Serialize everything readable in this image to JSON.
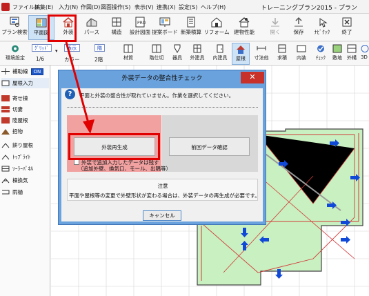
{
  "menubar": {
    "items": [
      "ファイル(F)",
      "編集(E)",
      "入力(N)",
      "作図(D)",
      "図面操作(S)",
      "表示(V)",
      "連携(X)",
      "設定(S)",
      "ヘルプ(H)"
    ],
    "window_title": "トレーニングプラン2015 - プラン"
  },
  "toolbar1": {
    "buttons": [
      "プラン検索",
      "平面図",
      "外装",
      "パース",
      "構造",
      "設計図面",
      "提案ボード",
      "新築積算",
      "リフォーム",
      "建物性能",
      "開く",
      "保存",
      "ﾅﾋﾞｸｯｸ",
      "終了"
    ]
  },
  "toolbar2": {
    "buttons": [
      "環境設定",
      "階仕切",
      "器具",
      "外建具",
      "内建具",
      "屋根",
      "寸法他",
      "求積",
      "内装",
      "ﾁｪｯｸ",
      "敷地",
      "外構",
      "3D"
    ],
    "combos": [
      {
        "label": "ｸﾞﾘｯﾄﾞ",
        "value": "1/6"
      },
      {
        "label": "表示",
        "value": "カラー"
      },
      {
        "label": "階",
        "value": "2階"
      }
    ],
    "material_label": "材質"
  },
  "left_panel": {
    "items": [
      "補助線",
      "屋根入力",
      "寄せ棟",
      "切妻",
      "陸屋根",
      "招物",
      "餅り屋根",
      "ﾄｯﾌﾟﾗｲﾄ",
      "ｿｰﾗｰﾊﾟﾈﾙ",
      "棟換気",
      "雨樋"
    ],
    "toggle_on": "ON"
  },
  "dialog": {
    "title": "外装データの整合性チェック",
    "close_glyph": "✕",
    "message": "平面と外装の整合性が取れていません。作業を選択してください。",
    "regen_button": "外装再生成",
    "prev_data_button": "前回データ確認",
    "checkbox_line1": "外装で追加入力したデータは残す",
    "checkbox_line2": "（追加外壁、換気口、モール、出隅等）",
    "note_heading": "注意",
    "note_text": "平面や屋根等の変更で外壁形状が変わる場合は、外装データの再生成が必要です。",
    "cancel_button": "キャンセル"
  },
  "colors": {
    "dialog_frame": "#6aa2dd",
    "highlight_red": "#e00000",
    "roof_green": "#c9f0c0",
    "arrow_blue": "#1048d8"
  }
}
